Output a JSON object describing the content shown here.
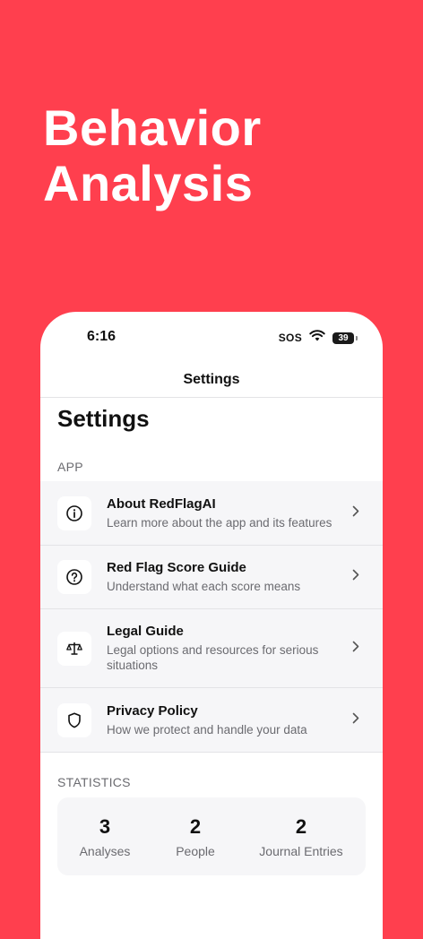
{
  "hero": {
    "line1": "Behavior",
    "line2": "Analysis"
  },
  "status_bar": {
    "time": "6:16",
    "sos": "SOS",
    "battery": "39"
  },
  "nav": {
    "title": "Settings"
  },
  "page": {
    "large_title": "Settings"
  },
  "sections": {
    "app": "APP",
    "statistics": "STATISTICS"
  },
  "settings_items": [
    {
      "title": "About RedFlagAI",
      "subtitle": "Learn more about the app and its features",
      "icon": "info-icon"
    },
    {
      "title": "Red Flag Score Guide",
      "subtitle": "Understand what each score means",
      "icon": "question-icon"
    },
    {
      "title": "Legal Guide",
      "subtitle": "Legal options and resources for serious situations",
      "icon": "scales-icon"
    },
    {
      "title": "Privacy Policy",
      "subtitle": "How we protect and handle your data",
      "icon": "shield-icon"
    }
  ],
  "statistics": [
    {
      "value": "3",
      "label": "Analyses"
    },
    {
      "value": "2",
      "label": "People"
    },
    {
      "value": "2",
      "label": "Journal Entries"
    }
  ],
  "colors": {
    "background": "#FF3F4E",
    "card": "#F6F6F8",
    "text": "#111111",
    "secondary": "#6B6B70"
  }
}
